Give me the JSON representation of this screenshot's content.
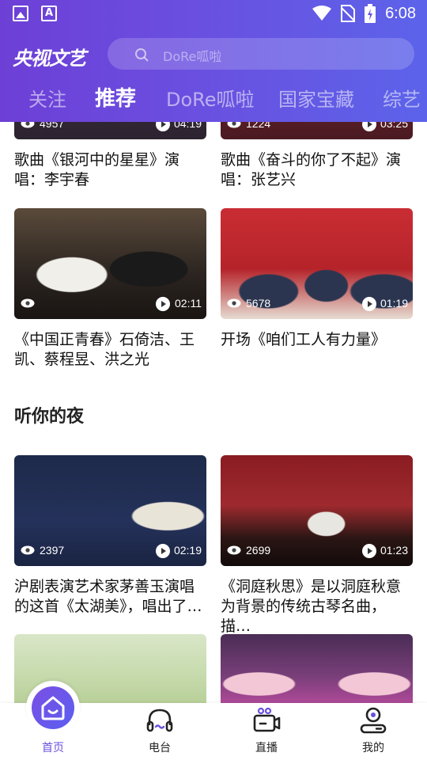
{
  "status_bar": {
    "time": "6:08",
    "left_icons": [
      "image-icon",
      "a-icon"
    ],
    "right_icons": [
      "wifi-icon",
      "no-sim-icon",
      "battery-icon"
    ]
  },
  "header": {
    "logo": "央视文艺",
    "search_placeholder": "DoRe呱啦",
    "tabs": [
      "关注",
      "推荐",
      "DoRe呱啦",
      "国家宝藏",
      "综艺"
    ],
    "active_tab": "推荐"
  },
  "feed": {
    "top_row": [
      {
        "views": "4957",
        "duration": "04:19",
        "title": "歌曲《银河中的星星》演唱：李宇春"
      },
      {
        "views": "1224",
        "duration": "03:25",
        "title": "歌曲《奋斗的你了不起》演唱：张艺兴"
      }
    ],
    "second_row": [
      {
        "views": "",
        "duration": "02:11",
        "title": "《中国正青春》石倚洁、王凯、蔡程昱、洪之光"
      },
      {
        "views": "5678",
        "duration": "01:19",
        "title": "开场《咱们工人有力量》"
      }
    ],
    "section_title": "听你的夜",
    "section_row": [
      {
        "views": "2397",
        "duration": "02:19",
        "title": "沪剧表演艺术家茅善玉演唱的这首《太湖美》，唱出了…"
      },
      {
        "views": "2699",
        "duration": "01:23",
        "title": "《洞庭秋思》是以洞庭秋意为背景的传统古琴名曲，描…"
      }
    ]
  },
  "bottom_nav": {
    "items": [
      {
        "label": "首页",
        "icon": "home-icon",
        "active": true
      },
      {
        "label": "电台",
        "icon": "headphones-icon",
        "active": false
      },
      {
        "label": "直播",
        "icon": "live-camera-icon",
        "active": false
      },
      {
        "label": "我的",
        "icon": "profile-icon",
        "active": false
      }
    ]
  },
  "colors": {
    "accent": "#6a4fe0",
    "header_start": "#6d3fd6",
    "header_end": "#5c63ea"
  }
}
